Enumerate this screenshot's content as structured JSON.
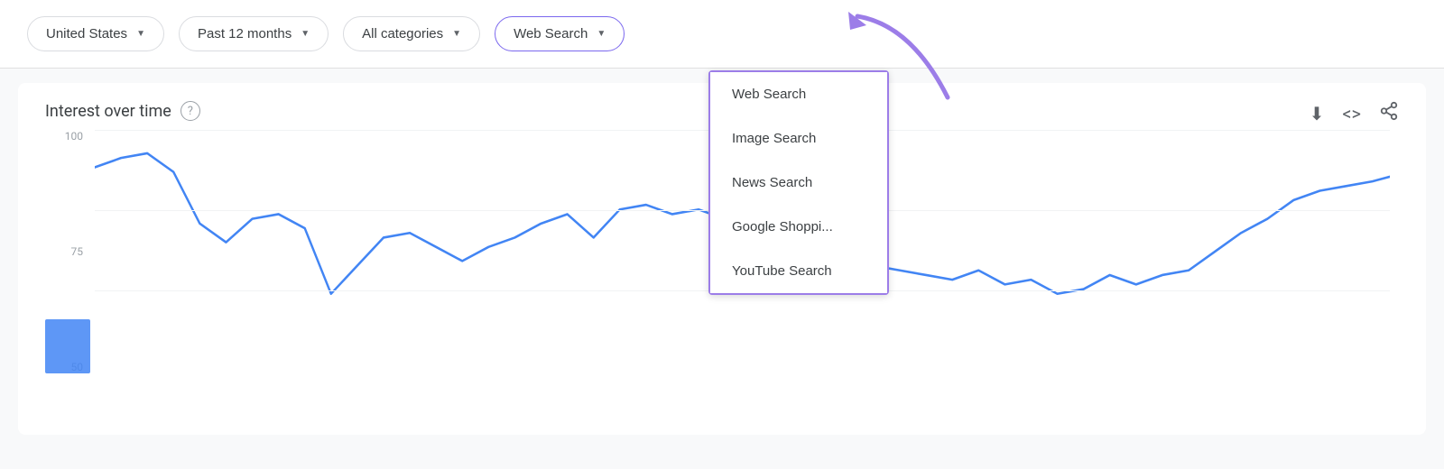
{
  "topbar": {
    "filters": [
      {
        "id": "country",
        "label": "United States"
      },
      {
        "id": "period",
        "label": "Past 12 months"
      },
      {
        "id": "category",
        "label": "All categories"
      },
      {
        "id": "search-type",
        "label": "Web Search"
      }
    ]
  },
  "dropdown": {
    "items": [
      {
        "id": "web-search",
        "label": "Web Search",
        "active": true
      },
      {
        "id": "image-search",
        "label": "Image Search",
        "active": false
      },
      {
        "id": "news-search",
        "label": "News Search",
        "active": false
      },
      {
        "id": "google-shopping",
        "label": "Google Shoppi...",
        "active": false
      },
      {
        "id": "youtube-search",
        "label": "YouTube Search",
        "active": false
      }
    ]
  },
  "chart": {
    "title": "Interest over time",
    "help_label": "?",
    "y_axis": [
      "100",
      "75",
      "50"
    ],
    "toolbar_icons": {
      "download": "⬇",
      "embed": "<>",
      "share": "⋮"
    }
  },
  "annotation_arrow": {
    "color": "#9c7de8"
  }
}
